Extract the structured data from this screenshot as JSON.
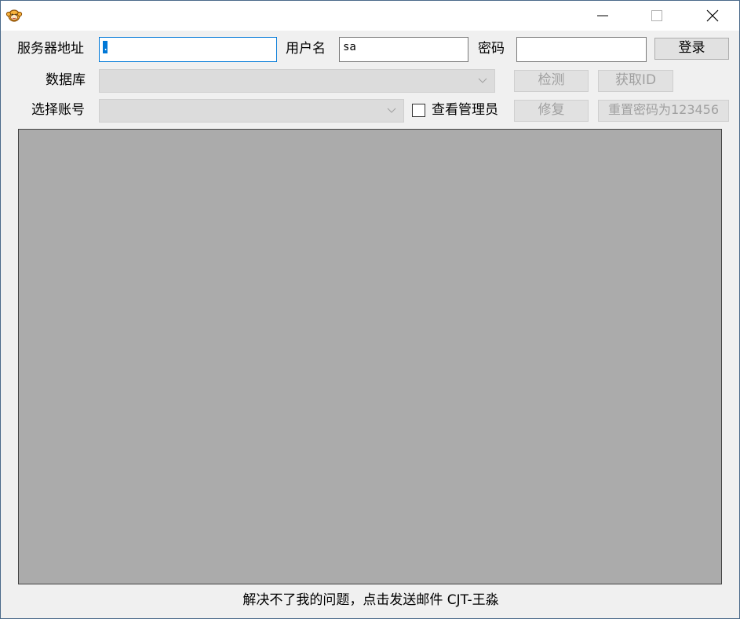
{
  "titlebar": {
    "app_icon": "monkey-face-icon",
    "minimize_icon": "minimize-icon",
    "maximize_icon": "maximize-icon",
    "close_icon": "close-icon"
  },
  "form": {
    "server_label": "服务器地址",
    "server_value": ".",
    "username_label": "用户名",
    "username_value": "sa",
    "password_label": "密码",
    "password_value": "",
    "login_button": "登录",
    "database_label": "数据库",
    "database_value": "",
    "check_button": "检测",
    "get_id_button": "获取ID",
    "account_label": "选择账号",
    "account_value": "",
    "show_admin_label": "查看管理员",
    "show_admin_checked": false,
    "repair_button": "修复",
    "reset_password_button": "重置密码为123456"
  },
  "footer": {
    "link_text": "解决不了我的问题，点击发送邮件 CJT-王淼"
  },
  "colors": {
    "panel_bg": "#ababab",
    "focus_border": "#0078d7",
    "disabled_text": "#a0a0a0"
  }
}
